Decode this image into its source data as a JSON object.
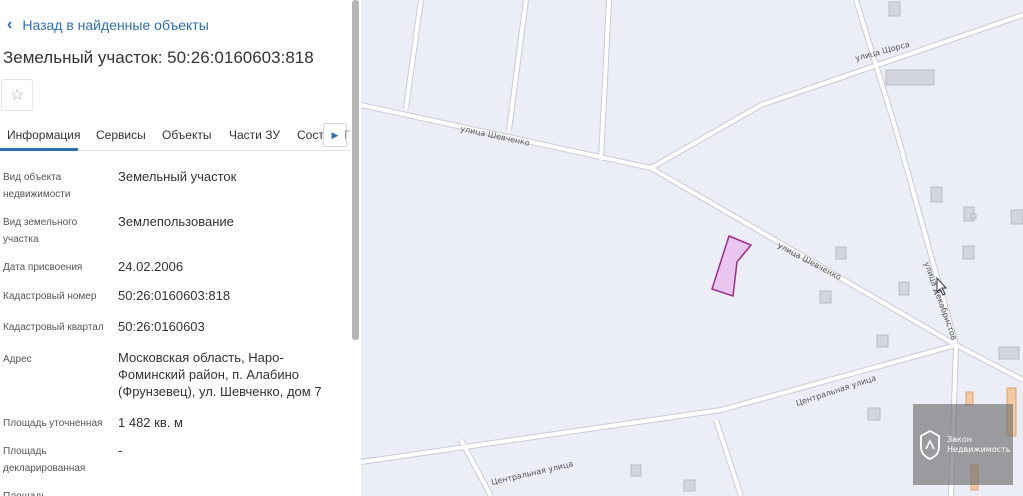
{
  "nav": {
    "back_label": "Назад в найденные объекты"
  },
  "object": {
    "title": "Земельный участок: 50:26:0160603:818"
  },
  "tabs": [
    "Информация",
    "Сервисы",
    "Объекты",
    "Части ЗУ",
    "Соста"
  ],
  "tabs_next": "Г",
  "fields": [
    {
      "label": "Вид объекта\nнедвижимости",
      "value": "Земельный участок"
    },
    {
      "label": "Вид земельного\nучастка",
      "value": "Землепользование"
    },
    {
      "label": "Дата присвоения",
      "value": "24.02.2006"
    },
    {
      "label": "Кадастровый номер",
      "value": "50:26:0160603:818"
    },
    {
      "label": "Кадастровый квартал",
      "value": "50:26:0160603"
    },
    {
      "label": "Адрес",
      "value": "Московская область, Наро-\nФоминский район, п. Алабино\n(Фрунзевец), ул. Шевченко, дом 7"
    },
    {
      "label": "Площадь уточненная",
      "value": "1 482 кв. м"
    },
    {
      "label": "Площадь\nдекларированная",
      "value": "-"
    },
    {
      "label": "Площадь",
      "value": ""
    }
  ],
  "map": {
    "streets": [
      "улица Шевченко",
      "улица Щорса",
      "улица Шевченко",
      "улица Декабристов",
      "Центральная улица",
      "Центральная улица"
    ],
    "parcel_fill": "#e8c6ef",
    "parcel_stroke": "#9b2d8e"
  },
  "watermark": {
    "line1": "Закон",
    "line2": "Недвижимость"
  }
}
